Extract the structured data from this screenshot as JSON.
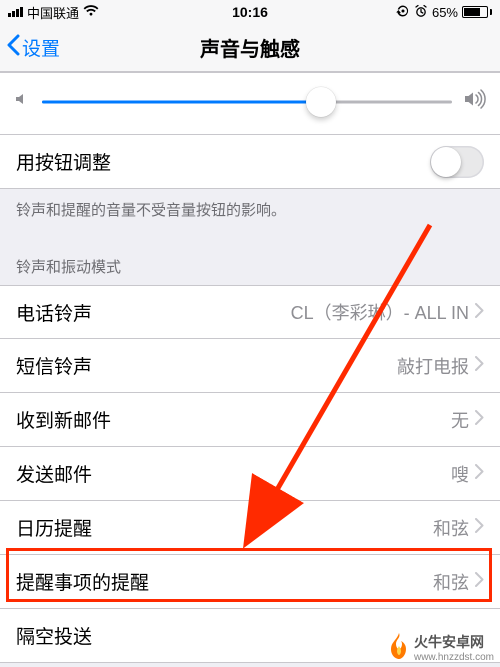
{
  "statusbar": {
    "carrier": "中国联通",
    "time": "10:16",
    "battery_pct": "65%"
  },
  "nav": {
    "back": "设置",
    "title": "声音与触感"
  },
  "volume": {
    "use_buttons_label": "用按钮调整",
    "footer": "铃声和提醒的音量不受音量按钮的影响。"
  },
  "section_ringtone_header": "铃声和振动模式",
  "rows": {
    "ringtone": {
      "label": "电话铃声",
      "value": "CL（李彩琳）- ALL IN"
    },
    "text_tone": {
      "label": "短信铃声",
      "value": "敲打电报"
    },
    "new_mail": {
      "label": "收到新邮件",
      "value": "无"
    },
    "sent_mail": {
      "label": "发送邮件",
      "value": "嗖"
    },
    "calendar": {
      "label": "日历提醒",
      "value": "和弦"
    },
    "reminders": {
      "label": "提醒事项的提醒",
      "value": "和弦"
    },
    "airdrop": {
      "label": "隔空投送",
      "value": ""
    }
  },
  "watermark": {
    "brand": "火牛安卓网",
    "url": "www.hnzzdst.com"
  }
}
